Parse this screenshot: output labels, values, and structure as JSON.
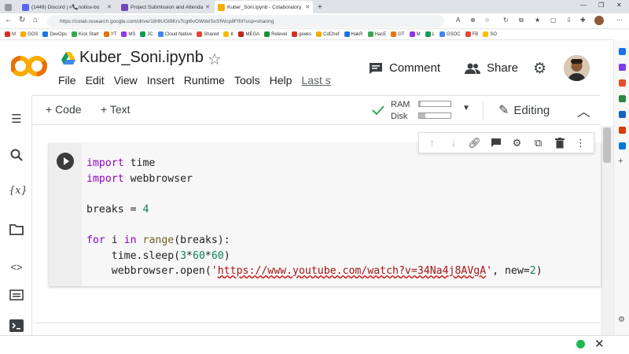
{
  "browser": {
    "tabs": [
      {
        "label": "(1449) Discord | #📞notice-bo",
        "active": false
      },
      {
        "label": "Project Submission and Attenda",
        "active": false
      },
      {
        "label": "Kuber_Soni.ipynb - Colaboratory",
        "active": true
      }
    ],
    "new_tab": "+",
    "url": "https://colab.research.google.com/drive/18r8UGt9KrsTcgt6vGWdxlSxSfWcp8FIfd?usp=sharing",
    "bookmarks": [
      "M",
      "GOS",
      "DevOps",
      "Kick Start",
      "YT",
      "MS",
      "JC",
      "Cloud Native",
      "Shared",
      "K",
      "MEGA",
      "Relevel",
      "geeks",
      "CdChef",
      "HakR",
      "HacE",
      "GT",
      "M",
      "L",
      "GSOC",
      "FB",
      "SO"
    ]
  },
  "colab": {
    "notebook_title": "Kuber_Soni.ipynb",
    "menu": [
      "File",
      "Edit",
      "View",
      "Insert",
      "Runtime",
      "Tools",
      "Help"
    ],
    "last_saved": "Last s",
    "comment_label": "Comment",
    "share_label": "Share",
    "toolbar": {
      "add_code": "+ Code",
      "add_text": "+ Text",
      "ram_label": "RAM",
      "disk_label": "Disk",
      "ram_fill": 0.05,
      "disk_fill": 0.2,
      "editing_label": "Editing"
    },
    "code_lines": [
      "import time",
      "import webbrowser",
      "",
      "breaks = 4",
      "",
      "for i in range(breaks):",
      "    time.sleep(3*60*60)",
      "    webbrowser.open('https://www.youtube.com/watch?v=34Na4j8AVgA', new=2)"
    ]
  },
  "colors": {
    "accent_orange": "#f9ab00",
    "keyword": "#9000c0",
    "number": "#098658",
    "string": "#a31515",
    "status_green": "#1db954"
  }
}
